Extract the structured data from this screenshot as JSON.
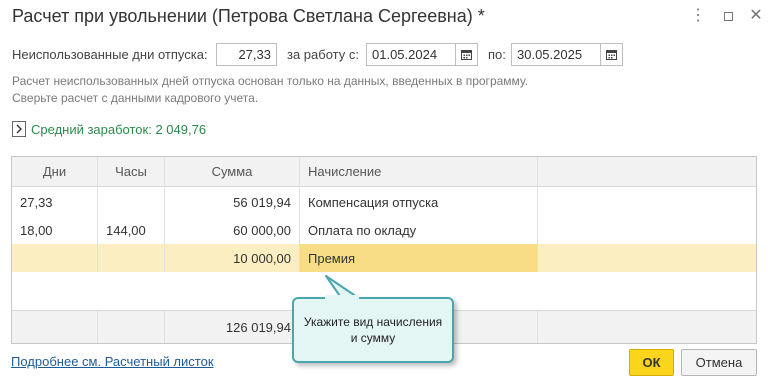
{
  "window": {
    "title": "Расчет при увольнении (Петрова Светлана Сергеевна) *",
    "more_icon": "more-vertical-icon",
    "maximize_icon": "maximize-icon",
    "close_icon": "close-icon"
  },
  "form": {
    "unused_days_label": "Неиспользованные дни отпуска:",
    "unused_days_value": "27,33",
    "period_from_label": "за работу с:",
    "period_from_value": "01.05.2024",
    "period_to_label": "по:",
    "period_to_value": "30.05.2025",
    "calendar_icon": "calendar-icon"
  },
  "note": {
    "line1": "Расчет неиспользованных дней отпуска основан только на данных, введенных в программу.",
    "line2": "Сверьте расчет с данными кадрового учета."
  },
  "average": {
    "text": "Средний заработок: 2 049,76",
    "icon": "chevron-right-icon",
    "color": "#2c8a4a"
  },
  "table": {
    "headers": [
      "Дни",
      "Часы",
      "Сумма",
      "Начисление"
    ],
    "rows": [
      {
        "days": "27,33",
        "hours": "",
        "amount": "56 019,94",
        "accrual": "Компенсация отпуска"
      },
      {
        "days": "18,00",
        "hours": "144,00",
        "amount": "60 000,00",
        "accrual": "Оплата по окладу"
      },
      {
        "days": "",
        "hours": "",
        "amount": "10 000,00",
        "accrual": "Премия"
      }
    ],
    "total_amount": "126 019,94",
    "selected_color": "#fbeec0"
  },
  "tooltip": {
    "line1": "Укажите вид начисления",
    "line2": "и сумму"
  },
  "footer": {
    "link": "Подробнее см. Расчетный листок",
    "ok_label": "ОК",
    "cancel_label": "Отмена",
    "ok_color": "#fad51c"
  }
}
